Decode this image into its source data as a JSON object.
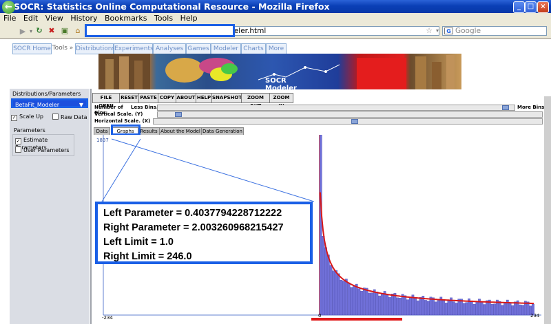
{
  "window": {
    "title": "SOCR: Statistics Online Computational Resource - Mozilla Firefox",
    "controls": [
      "_",
      "□",
      "×"
    ]
  },
  "menu": [
    "File",
    "Edit",
    "View",
    "History",
    "Bookmarks",
    "Tools",
    "Help"
  ],
  "nav": {
    "url": "http://socr.ucla.edu/htmls/SOCR_Modeler.html",
    "search_placeholder": "Google",
    "search_engine_icon": "G"
  },
  "socr_tabs": [
    "SOCR Home",
    "Tools »",
    "Distributions",
    "Experiments",
    "Analyses",
    "Games",
    "Modeler",
    "Charts",
    "More"
  ],
  "banner": {
    "title": "SOCR Modeler"
  },
  "left_panel": {
    "section_label": "Distributions/Parameters",
    "selected_distribution": "BetaFit_Modeler",
    "scale_up": "Scale Up",
    "raw_data": "Raw Data",
    "parameters_label": "Parameters",
    "estimate_parameters": "Estimate Parameters",
    "user_parameters": "User Parameters"
  },
  "toolbar": [
    "FILE OPEN",
    "RESET",
    "PASTE",
    "COPY",
    "ABOUT",
    "HELP",
    "SNAPSHOT",
    "ZOOM OUT",
    "ZOOM IN"
  ],
  "sliders": {
    "bins_label": "Number of Bins.",
    "less_bins": "Less Bins.",
    "more_bins": "More Bins.",
    "vertical_label": "Vertical Scale. (Y)",
    "horizontal_label": "Horizontal Scale. (X)"
  },
  "subtabs": [
    "Data",
    "Graphs",
    "Results",
    "About the Model",
    "Data Generation"
  ],
  "active_subtab": "Graphs",
  "chart": {
    "y_top_label": "1837",
    "x_left_label": "-234",
    "x_zero_label": "0",
    "x_right_label": "234"
  },
  "chart_data": {
    "type": "bar",
    "ylim": [
      0,
      1837
    ],
    "xlim": [
      -234,
      234
    ],
    "bar_color": "#7070d8",
    "fit_color": "#d81818"
  },
  "annotation": {
    "left_parameter": "Left Parameter = 0.4037794228712222",
    "right_parameter": "Right Parameter = 2.003260968215427",
    "left_limit": "Left Limit = 1.0",
    "right_limit": "Right Limit = 246.0"
  },
  "colors": {
    "highlight": "#1a5fe6",
    "titlebar": "#0a3fb6"
  }
}
